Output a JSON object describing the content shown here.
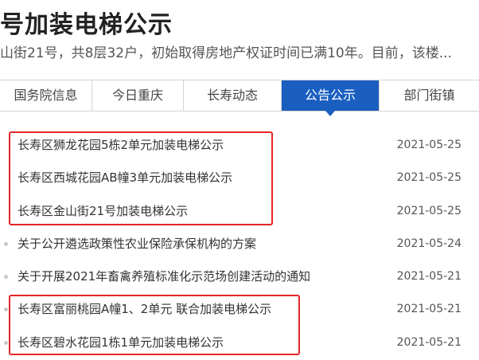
{
  "article": {
    "headline": "号加装电梯公示",
    "summary": "山街21号，共8层32户，初始取得房地产权证时间已满10年。目前，该楼..."
  },
  "tabs": [
    {
      "label": "国务院信息",
      "active": false
    },
    {
      "label": "今日重庆",
      "active": false
    },
    {
      "label": "长寿动态",
      "active": false
    },
    {
      "label": "公告公示",
      "active": true
    },
    {
      "label": "部门街镇",
      "active": false
    }
  ],
  "news": [
    {
      "title": "长寿区狮龙花园5栋2单元加装电梯公示",
      "date": "2021-05-25"
    },
    {
      "title": "长寿区西城花园AB幢3单元加装电梯公示",
      "date": "2021-05-25"
    },
    {
      "title": "长寿区金山街21号加装电梯公示",
      "date": "2021-05-25"
    },
    {
      "title": "关于公开遴选政策性农业保险承保机构的方案",
      "date": "2021-05-24"
    },
    {
      "title": "关于开展2021年畜禽养殖标准化示范场创建活动的通知",
      "date": "2021-05-21"
    },
    {
      "title": "长寿区富丽桃园A幢1、2单元 联合加装电梯公示",
      "date": "2021-05-21"
    },
    {
      "title": "长寿区碧水花园1栋1单元加装电梯公示",
      "date": "2021-05-21"
    }
  ],
  "colors": {
    "active_tab": "#1a5ec0",
    "highlight_box": "#e52626",
    "bullet": "#c8c8c8"
  }
}
